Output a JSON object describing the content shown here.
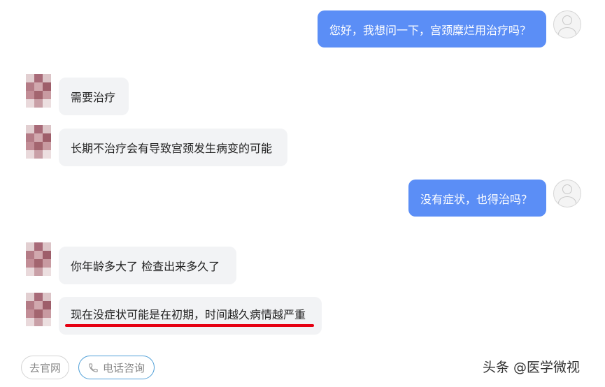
{
  "messages": [
    {
      "sender": "user",
      "text": "您好，我想问一下，宫颈糜烂用治疗吗？"
    },
    {
      "sender": "doctor",
      "text": "需要治疗"
    },
    {
      "sender": "doctor",
      "text": "长期不治疗会有导致宫颈发生病变的可能"
    },
    {
      "sender": "user",
      "text": "没有症状，也得治吗？"
    },
    {
      "sender": "doctor",
      "text": "你年龄多大了 检查出来多久了"
    },
    {
      "sender": "doctor",
      "text": "现在没症状可能是在初期，时间越久病情越严重",
      "highlight": "red-underline"
    }
  ],
  "actions": {
    "site_label": "去官网",
    "phone_label": "电话咨询",
    "phone_icon": "phone-icon"
  },
  "watermark": "头条 @医学微视",
  "colors": {
    "user_bubble": "#5b8ef6",
    "doctor_bubble": "#f2f3f5",
    "highlight": "#e60012",
    "phone_border": "#4f9fd7"
  }
}
